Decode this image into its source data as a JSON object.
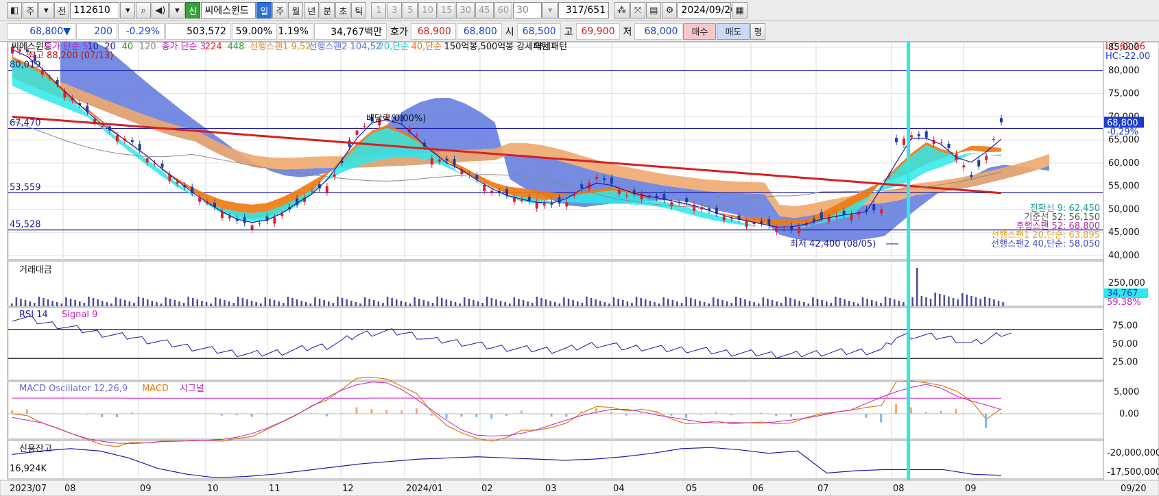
{
  "toolbar": {
    "period": "주",
    "prev": "전",
    "code": "112610",
    "name": "씨에스윈드",
    "badge": "신",
    "periods": [
      "일",
      "주",
      "월",
      "년",
      "분",
      "초",
      "틱"
    ],
    "intervals": [
      "1",
      "3",
      "5",
      "10",
      "15",
      "30",
      "45",
      "60"
    ],
    "interval_sel": "30",
    "count": "317",
    "total": "/651",
    "date": "2024/09/20"
  },
  "quote": {
    "price": "68,800▼",
    "change": "200",
    "rate": "-0.29%",
    "volume": "503,572",
    "ratio1": "59.00%",
    "ratio2": "1.19%",
    "amount": "34,767백만",
    "ask_label": "호가",
    "ask": "68,900",
    "bid": "68,800",
    "open_label": "시",
    "open": "68,500",
    "high_label": "고",
    "high": "69,900",
    "low_label": "저",
    "low": "68,000",
    "buy": "매수",
    "sell": "매도",
    "avg": "평"
  },
  "legend": {
    "name": "씨에스윈드",
    "ma_label": "종가 단순 5",
    "ma10": "10",
    "ma20": "20",
    "ma40": "40",
    "ma120": "120",
    "ma2_label": "종가 단순 3",
    "ma224": "224",
    "ma448": "448",
    "span1": "선행스팬1 9,52",
    "span2": "선행스팬2 104,52",
    "s20": "20,단순",
    "s40": "40,단순",
    "pattern": "150억봉,500억봉 강세패턴",
    "weak": "약세패턴"
  },
  "annotations": {
    "top_high": "최고 88,200 (07/13)",
    "dividend": "배당락(0.00%)",
    "low": "최저 42,400 (08/05)",
    "lc": "LC:62.26",
    "hc": "HC:-22.00"
  },
  "price_axis": {
    "ticks": [
      "85,000",
      "80,000",
      "75,000",
      "70,000",
      "65,000",
      "60,000",
      "55,000",
      "50,000",
      "45,000",
      "40,000"
    ],
    "current": "68,800",
    "current_rate": "-0.29%"
  },
  "levels": [
    "80,019",
    "67,470",
    "53,559",
    "45,528"
  ],
  "right_labels": [
    "전환선 9: 62,450",
    "기준선 52: 56,150",
    "후행스팬 52: 68,800",
    "선행스팬1 20,단순: 63,895",
    "선행스팬2 40,단순: 58,050"
  ],
  "panels": {
    "amount_title": "거래대금",
    "amount_ticks": [
      "250,000"
    ],
    "amount_current": "34,767",
    "amount_pct": "59.38%",
    "rsi_title": "RSI 14",
    "rsi_signal": "Signal 9",
    "rsi_ticks": [
      "75.00",
      "50.00",
      "25.00"
    ],
    "macd_title": "MACD Oscillator 12,26,9",
    "macd_label": "MACD",
    "macd_signal": "시그널",
    "macd_ticks": [
      "5,000",
      "0.00"
    ],
    "credit_title": "신용잔고",
    "credit_value": "16,924K",
    "credit_ticks": [
      "-20,000,000",
      "-17,500,000"
    ]
  },
  "x_axis": {
    "labels": [
      "2023/07",
      "08",
      "09",
      "10",
      "11",
      "12",
      "2024/01",
      "02",
      "03",
      "04",
      "05",
      "06",
      "07",
      "08",
      "09"
    ],
    "right": "09/20"
  },
  "colors": {
    "up": "#e0202a",
    "down": "#1f3ea8",
    "cloud_pos": "#f0a86e",
    "cloud_neg": "#6f86e0",
    "cyan": "#2fe8ea",
    "orange": "#f07a10",
    "ma224": "#d62020"
  },
  "chart_data": {
    "type": "candlestick",
    "symbol": "112610",
    "period": "daily",
    "price_ylim": [
      40000,
      85000
    ],
    "last": {
      "date": "2024/09/20",
      "open": 68500,
      "high": 69900,
      "low": 68000,
      "close": 68800,
      "change": -200,
      "change_pct": -0.29,
      "volume": 503572
    },
    "high_annot": {
      "value": 88200,
      "date": "07/13"
    },
    "low_annot": {
      "value": 42400,
      "date": "08/05"
    },
    "horizontal_levels": [
      80019,
      67470,
      53559,
      45528
    ],
    "rsi_levels": [
      70,
      30
    ],
    "ichimoku": {
      "conversion": 62450,
      "base": 56150,
      "lagging": 68800,
      "lead1": 63895,
      "lead2": 58050
    },
    "close_series": [
      85000,
      84000,
      80000,
      77000,
      74000,
      71000,
      68000,
      66000,
      64500,
      61000,
      59000,
      56000,
      53500,
      51500,
      49500,
      47500,
      46500,
      47500,
      49000,
      51000,
      54000,
      55000,
      60000,
      67000,
      69000,
      70000,
      69000,
      66000,
      61000,
      60500,
      58500,
      56500,
      54000,
      53000,
      52000,
      51500,
      51000,
      51500,
      54500,
      57000,
      55500,
      53000,
      53500,
      52500,
      51500,
      51500,
      50500,
      49000,
      48000,
      47500,
      47000,
      46000,
      45500,
      47000,
      48000,
      48500,
      49000,
      49500,
      50000,
      64500,
      66000,
      65500,
      64500,
      62000,
      57000,
      61500,
      68800
    ],
    "credit_series": [
      19.3,
      19.6,
      19.8,
      19.6,
      19.0,
      18.1,
      17.6,
      17.3,
      17.4,
      17.6,
      17.9,
      18.2,
      18.5,
      18.7,
      18.9,
      19.0,
      19.1,
      19.0,
      18.9,
      18.8,
      18.9,
      19.1,
      19.4,
      19.8,
      19.9,
      19.7,
      19.4,
      19.6,
      17.7,
      17.9,
      18.0,
      18.0,
      18.0,
      17.6,
      17.5
    ]
  }
}
